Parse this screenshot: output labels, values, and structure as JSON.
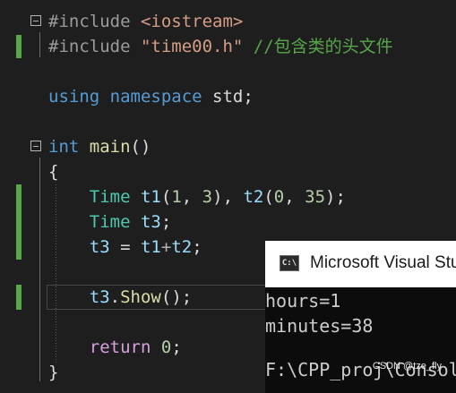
{
  "editor": {
    "lines": [
      {
        "tokens": [
          {
            "cls": "pp",
            "text": "#include "
          },
          {
            "cls": "str",
            "text": "<iostream>"
          }
        ]
      },
      {
        "tokens": [
          {
            "cls": "pp",
            "text": "#include "
          },
          {
            "cls": "str",
            "text": "\"time00.h\" "
          },
          {
            "cls": "cm",
            "text": "//包含类的头文件"
          }
        ]
      },
      {
        "tokens": []
      },
      {
        "tokens": [
          {
            "cls": "kw",
            "text": "using"
          },
          {
            "cls": "",
            "text": " "
          },
          {
            "cls": "kw",
            "text": "namespace"
          },
          {
            "cls": "",
            "text": " std;"
          }
        ]
      },
      {
        "tokens": []
      },
      {
        "tokens": [
          {
            "cls": "kw",
            "text": "int"
          },
          {
            "cls": "",
            "text": " "
          },
          {
            "cls": "fn",
            "text": "main"
          },
          {
            "cls": "",
            "text": "()"
          }
        ]
      },
      {
        "tokens": [
          {
            "cls": "",
            "text": "{"
          }
        ]
      },
      {
        "tokens": [
          {
            "cls": "",
            "text": "    "
          },
          {
            "cls": "ty",
            "text": "Time"
          },
          {
            "cls": "",
            "text": " "
          },
          {
            "cls": "var",
            "text": "t1"
          },
          {
            "cls": "",
            "text": "("
          },
          {
            "cls": "num",
            "text": "1"
          },
          {
            "cls": "",
            "text": ", "
          },
          {
            "cls": "num",
            "text": "3"
          },
          {
            "cls": "",
            "text": "), "
          },
          {
            "cls": "var",
            "text": "t2"
          },
          {
            "cls": "",
            "text": "("
          },
          {
            "cls": "num",
            "text": "0"
          },
          {
            "cls": "",
            "text": ", "
          },
          {
            "cls": "num",
            "text": "35"
          },
          {
            "cls": "",
            "text": ");"
          }
        ]
      },
      {
        "tokens": [
          {
            "cls": "",
            "text": "    "
          },
          {
            "cls": "ty",
            "text": "Time"
          },
          {
            "cls": "",
            "text": " "
          },
          {
            "cls": "var",
            "text": "t3"
          },
          {
            "cls": "",
            "text": ";"
          }
        ]
      },
      {
        "tokens": [
          {
            "cls": "",
            "text": "    "
          },
          {
            "cls": "var",
            "text": "t3"
          },
          {
            "cls": "",
            "text": " = "
          },
          {
            "cls": "var",
            "text": "t1"
          },
          {
            "cls": "op",
            "text": "+"
          },
          {
            "cls": "var",
            "text": "t2"
          },
          {
            "cls": "",
            "text": ";"
          }
        ]
      },
      {
        "tokens": []
      },
      {
        "tokens": [
          {
            "cls": "",
            "text": "    "
          },
          {
            "cls": "var",
            "text": "t3"
          },
          {
            "cls": "",
            "text": "."
          },
          {
            "cls": "fn",
            "text": "Show"
          },
          {
            "cls": "",
            "text": "();"
          }
        ]
      },
      {
        "tokens": []
      },
      {
        "tokens": [
          {
            "cls": "",
            "text": "    "
          },
          {
            "cls": "ctl",
            "text": "return"
          },
          {
            "cls": "",
            "text": " "
          },
          {
            "cls": "num",
            "text": "0"
          },
          {
            "cls": "",
            "text": ";"
          }
        ]
      },
      {
        "tokens": [
          {
            "cls": "",
            "text": "}"
          }
        ]
      }
    ]
  },
  "console": {
    "icon_text": "C:\\",
    "title": "Microsoft Visual Studio 调试控制台",
    "output": [
      "hours=1",
      "minutes=38",
      "",
      "F:\\CPP_proj\\Console"
    ]
  },
  "watermark": "CSDN @tze_fly",
  "colors": {
    "editor_bg": "#1e1e1e",
    "keyword": "#569cd6",
    "string": "#d69d85",
    "comment": "#57a64a",
    "type": "#4ec9b0",
    "function": "#dcdcaa",
    "control": "#d8a0df",
    "number": "#b5cea8",
    "variable": "#9cdcfe",
    "change_bar": "#57a64a"
  }
}
